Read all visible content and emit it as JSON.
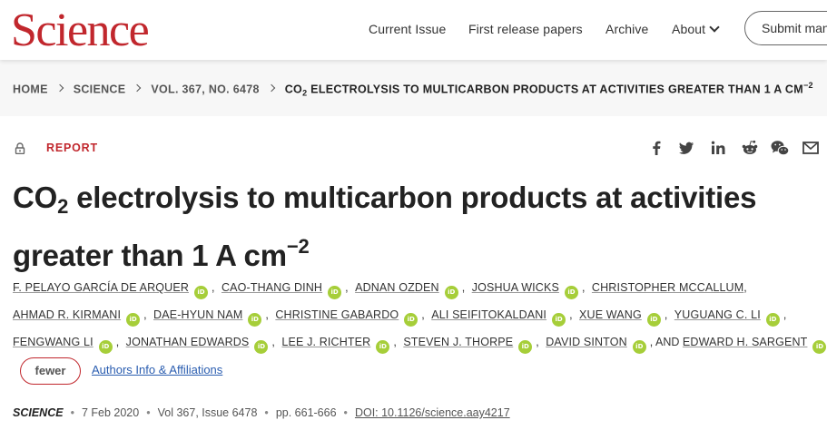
{
  "header": {
    "logo_text": "Science",
    "nav": [
      {
        "label": "Current Issue"
      },
      {
        "label": "First release papers"
      },
      {
        "label": "Archive"
      },
      {
        "label": "About"
      }
    ],
    "submit_label": "Submit man"
  },
  "breadcrumb": {
    "items": [
      "HOME",
      "SCIENCE",
      "VOL. 367, NO. 6478"
    ],
    "current_pre": "CO",
    "current_sub": "2",
    "current_main": " ELECTROLYSIS TO MULTICARBON PRODUCTS AT ACTIVITIES GREATER THAN 1 A CM",
    "current_sup": "−2"
  },
  "article": {
    "type_label": "REPORT",
    "title_pre": "CO",
    "title_sub": "2",
    "title_line1_rest": " electrolysis to multicarbon products at activities",
    "title_line2": "greater than 1 A cm",
    "title_sup": "−2",
    "share_icons": [
      "facebook-icon",
      "twitter-icon",
      "linkedin-icon",
      "reddit-icon",
      "wechat-icon",
      "email-icon"
    ]
  },
  "authors": {
    "row1": [
      "F. PELAYO GARCÍA DE ARQUER",
      "CAO-THANG DINH",
      "ADNAN OZDEN",
      "JOSHUA WICKS",
      "CHRISTOPHER MCCALLUM"
    ],
    "row2": [
      "AHMAD R. KIRMANI",
      "DAE-HYUN NAM",
      "CHRISTINE GABARDO",
      "ALI SEIFITOKALDANI",
      "XUE WANG",
      "YUGUANG C. LI"
    ],
    "row3": [
      "FENGWANG LI",
      "JONATHAN EDWARDS",
      "LEE J. RICHTER",
      "STEVEN J. THORPE",
      "DAVID SINTON"
    ],
    "last_prefix": ", AND ",
    "last": "EDWARD H. SARGENT",
    "orcid_text": "iD",
    "fewer_label": "fewer",
    "affiliations_label": "Authors Info & Affiliations"
  },
  "meta": {
    "journal": "SCIENCE",
    "date": "7 Feb 2020",
    "volume": "Vol 367, Issue 6478",
    "pages": "pp. 661-666",
    "doi": "DOI: 10.1126/science.aay4217"
  },
  "colors": {
    "brand_red": "#c1272d",
    "orcid_green": "#a6ce39",
    "link_blue": "#2a5db0"
  }
}
